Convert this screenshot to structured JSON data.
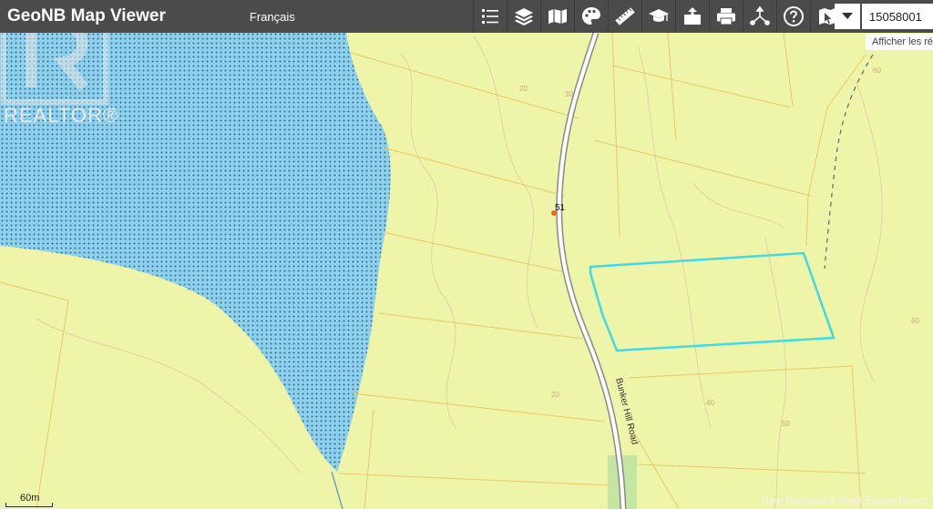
{
  "header": {
    "title": "GeoNB Map Viewer",
    "language_link": "Français"
  },
  "toolbar": {
    "tools": [
      {
        "icon": "list-icon"
      },
      {
        "icon": "layers-icon"
      },
      {
        "icon": "basemap-icon"
      },
      {
        "icon": "palette-icon"
      },
      {
        "icon": "measure-ruler-icon"
      },
      {
        "icon": "education-icon"
      },
      {
        "icon": "upload-icon"
      },
      {
        "icon": "print-icon"
      },
      {
        "icon": "share-icon"
      },
      {
        "icon": "help-icon"
      },
      {
        "icon": "identify-icon"
      }
    ]
  },
  "search": {
    "value": "15058001",
    "results_link": "Afficher les ré"
  },
  "map": {
    "road_number": "51",
    "road_name": "Bunker Hill Road",
    "contours": [
      "20",
      "30",
      "20",
      "40",
      "50",
      "60",
      "60"
    ],
    "colors": {
      "land": "#eef5a8",
      "water": "#7cc4e3",
      "parcel_lines": "#e8c86a",
      "selected_parcel": "#41d9e8",
      "road": "#8a8a8a"
    }
  },
  "watermark": "REALTOR®",
  "scale": "60m",
  "attribution": "New Brunswick Real Estate Board"
}
